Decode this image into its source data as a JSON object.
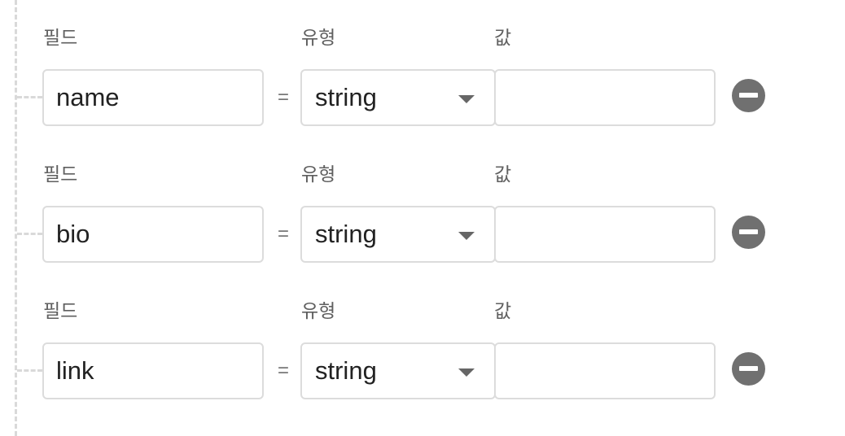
{
  "labels": {
    "field": "필드",
    "type": "유형",
    "value": "값",
    "equals": "="
  },
  "rows": [
    {
      "field": "name",
      "type": "string",
      "value": ""
    },
    {
      "field": "bio",
      "type": "string",
      "value": ""
    },
    {
      "field": "link",
      "type": "string",
      "value": ""
    }
  ],
  "icons": {
    "remove": "minus-circle-icon",
    "dropdown": "caret-down-icon"
  },
  "colors": {
    "label": "#5f5f5f",
    "border": "#dcdcdc",
    "remove_button": "#707070",
    "tree_line": "#d9d9d9"
  }
}
